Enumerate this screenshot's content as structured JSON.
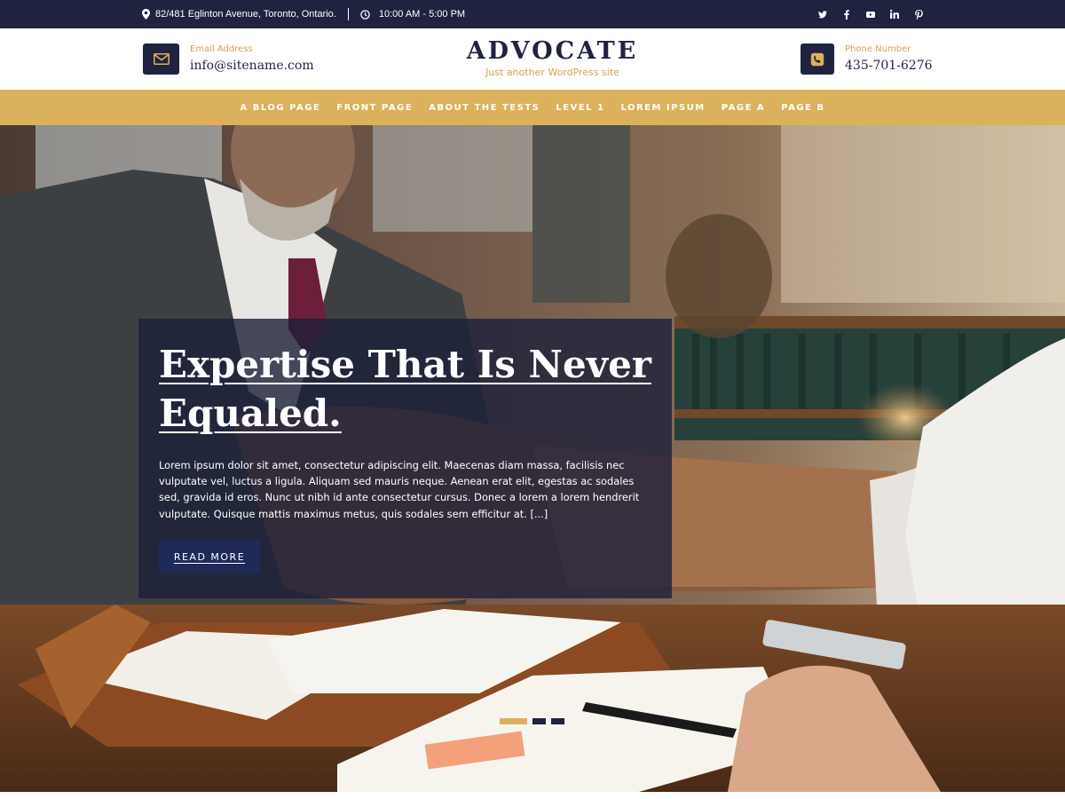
{
  "topbar": {
    "address": "82/481 Eglinton Avenue, Toronto, Ontario.",
    "hours": "10:00 AM - 5:00 PM",
    "social": [
      "twitter-icon",
      "facebook-icon",
      "youtube-icon",
      "linkedin-icon",
      "pinterest-icon"
    ]
  },
  "header": {
    "email_label": "Email Address",
    "email_value": "info@sitename.com",
    "site_title": "ADVOCATE",
    "tagline": "Just another WordPress site",
    "phone_label": "Phone Number",
    "phone_value": "435-701-6276"
  },
  "nav": {
    "items": [
      "A BLOG PAGE",
      "FRONT PAGE",
      "ABOUT THE TESTS",
      "LEVEL 1",
      "LOREM IPSUM",
      "PAGE A",
      "PAGE B"
    ]
  },
  "hero": {
    "title": "Expertise That Is Never Equaled.",
    "text": "Lorem ipsum dolor sit amet, consectetur adipiscing elit. Maecenas diam massa, facilisis nec vulputate vel, luctus a ligula. Aliquam sed mauris neque. Aenean erat elit, egestas ac sodales sed, gravida id eros. Nunc ut nibh id ante consectetur cursus. Donec a lorem a lorem hendrerit vulputate. Quisque mattis maximus metus, quis sodales sem efficitur at. [...]",
    "button_label": "READ MORE",
    "slides": 3,
    "active_slide": 1
  },
  "colors": {
    "navy": "#1f2340",
    "gold": "#dcb15c",
    "gold_text": "#d3a24e",
    "button": "#1f2a5a"
  }
}
